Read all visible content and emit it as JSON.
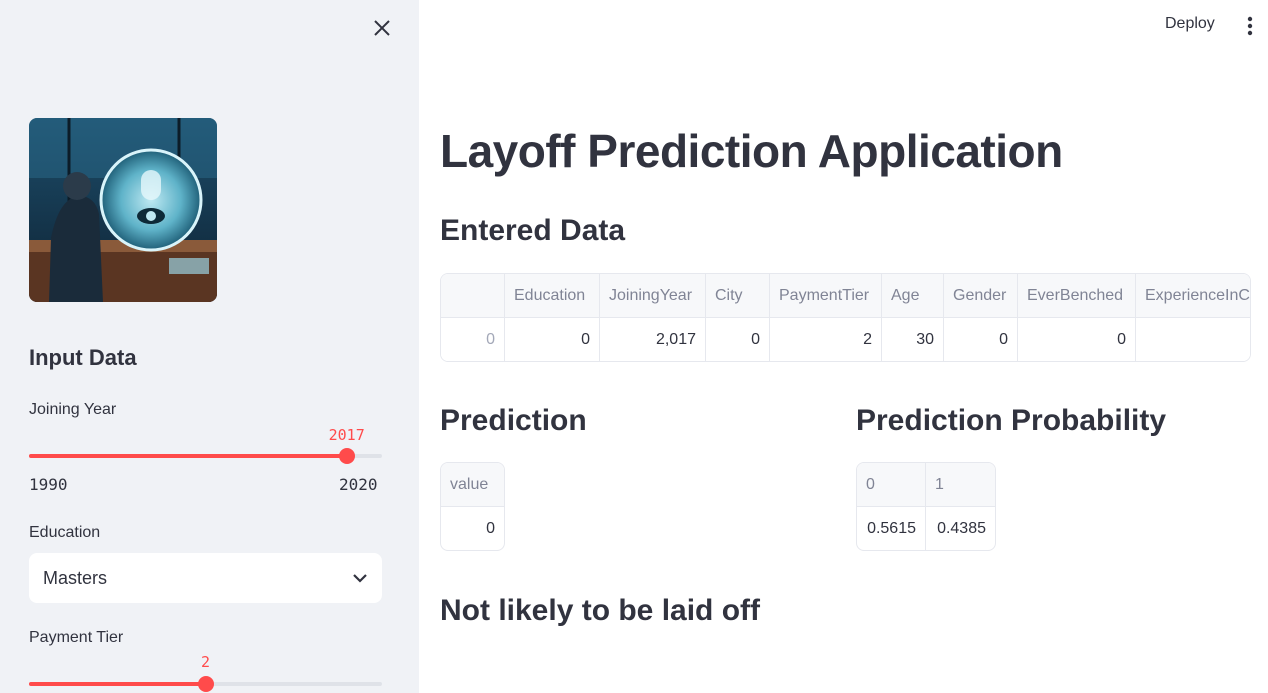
{
  "sidebar": {
    "close_icon": "close-icon",
    "logo_alt": "robot-eye-illustration",
    "header": "Input Data",
    "joining_year": {
      "label": "Joining Year",
      "value": 2017,
      "value_text": "2017",
      "min": 1990,
      "max": 2020,
      "min_text": "1990",
      "max_text": "2020",
      "fraction": 0.9
    },
    "education": {
      "label": "Education",
      "selected": "Masters"
    },
    "payment_tier": {
      "label": "Payment Tier",
      "value": 2,
      "value_text": "2",
      "fraction": 0.5
    }
  },
  "topbar": {
    "deploy_label": "Deploy",
    "menu_icon": "kebab-menu-icon"
  },
  "main": {
    "title": "Layoff Prediction Application",
    "entered_data": {
      "heading": "Entered Data",
      "columns": [
        "",
        "Education",
        "JoiningYear",
        "City",
        "PaymentTier",
        "Age",
        "Gender",
        "EverBenched",
        "ExperienceInCu"
      ],
      "rows": [
        [
          "0",
          "0",
          "2,017",
          "0",
          "2",
          "30",
          "0",
          "0",
          ""
        ]
      ]
    },
    "prediction": {
      "heading": "Prediction",
      "columns": [
        "value"
      ],
      "rows": [
        [
          "0"
        ]
      ]
    },
    "probability": {
      "heading": "Prediction Probability",
      "columns": [
        "0",
        "1"
      ],
      "rows": [
        [
          "0.5615",
          "0.4385"
        ]
      ]
    },
    "result_text": "Not likely to be laid off"
  },
  "colors": {
    "accent": "#ff4b4b",
    "sidebar_bg": "#f0f2f6",
    "text": "#31333f"
  }
}
